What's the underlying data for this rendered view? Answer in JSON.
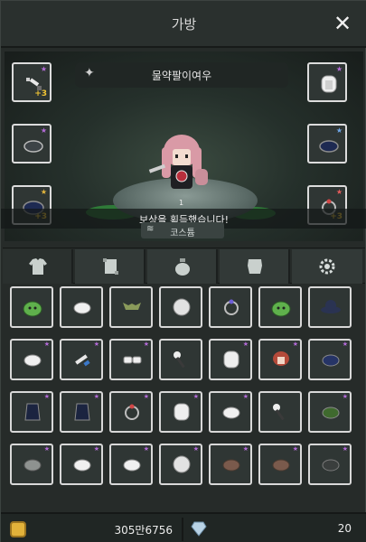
{
  "window": {
    "title": "가방"
  },
  "character": {
    "name": "물약팔이여우",
    "level": "1"
  },
  "equipment_left": [
    {
      "name": "sword",
      "star": "purple",
      "plus": "+3"
    },
    {
      "name": "gloves",
      "star": "purple",
      "plus": ""
    },
    {
      "name": "hat",
      "star": "gold",
      "plus": "+3"
    }
  ],
  "equipment_right": [
    {
      "name": "hood",
      "star": "purple",
      "plus": ""
    },
    {
      "name": "boots",
      "star": "blue",
      "plus": ""
    },
    {
      "name": "ring",
      "star": "red",
      "plus": "+3"
    }
  ],
  "reward": {
    "message": "보상을 획득했습니다!"
  },
  "costume": {
    "label": "코스튬"
  },
  "tabs": [
    {
      "name": "armor-tab",
      "icon": "shirt-icon"
    },
    {
      "name": "scroll-tab",
      "icon": "scroll-icon"
    },
    {
      "name": "pouch-tab",
      "icon": "pouch-icon"
    },
    {
      "name": "material-tab",
      "icon": "hide-icon"
    },
    {
      "name": "settings-tab",
      "icon": "gear-icon"
    }
  ],
  "inventory": [
    [
      "green-slime-icon",
      "white-gloves-icon",
      "mask-icon",
      "white-orb-icon",
      "ring-icon",
      "green-slime-icon",
      "black-hat-icon"
    ],
    [
      "white-gloves-icon",
      "dagger-icon",
      "white-boots-icon",
      "staff-icon",
      "white-hood-icon",
      "red-hair-icon",
      "navy-gloves-icon"
    ],
    [
      "dark-cape-icon",
      "dark-cape-icon",
      "red-ring-icon",
      "white-hood-icon",
      "white-gloves-icon",
      "staff-icon",
      "green-gloves-icon"
    ],
    [
      "grey-gloves-icon",
      "white-gloves-icon",
      "white-gloves-icon",
      "white-orb-icon",
      "brown-boots-icon",
      "brown-boots-icon",
      "dark-boots-icon"
    ]
  ],
  "currency": {
    "gold": "305만6756",
    "gems": "20"
  },
  "colors": {
    "star_purple": "#b46bd8",
    "star_gold": "#e4b73d",
    "star_blue": "#6fa7e8",
    "star_red": "#e55b5b",
    "plus": "#f2c534"
  }
}
